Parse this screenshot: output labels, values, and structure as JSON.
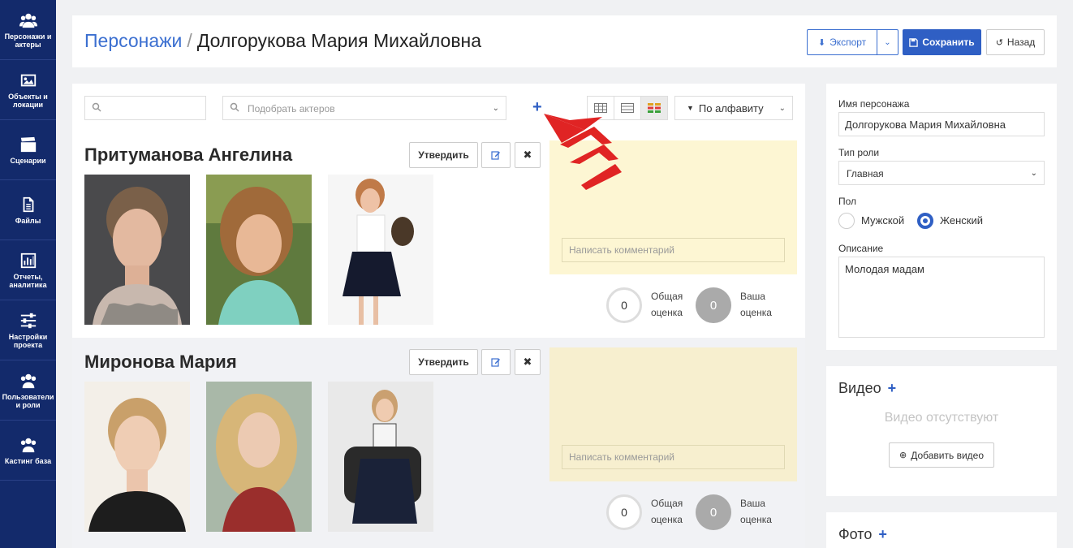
{
  "sidebar": {
    "items": [
      {
        "label": "Персонажи и актеры",
        "icon": "users-icon"
      },
      {
        "label": "Объекты и локации",
        "icon": "image-icon"
      },
      {
        "label": "Сценарии",
        "icon": "clapperboard-icon"
      },
      {
        "label": "Файлы",
        "icon": "file-icon"
      },
      {
        "label": "Отчеты, аналитика",
        "icon": "chart-icon"
      },
      {
        "label": "Настройки проекта",
        "icon": "sliders-icon"
      },
      {
        "label": "Пользователи и роли",
        "icon": "users-icon"
      },
      {
        "label": "Кастинг база",
        "icon": "users-icon"
      }
    ]
  },
  "header": {
    "breadcrumb": "Персонажи",
    "separator": "/",
    "title": "Долгорукова Мария Михайловна",
    "export_label": "Экспорт",
    "save_label": "Сохранить",
    "back_label": "Назад"
  },
  "toolbar": {
    "search_placeholder": "",
    "actor_pick_placeholder": "Подобрать актеров",
    "add_symbol": "+",
    "sort_label": "По алфавиту"
  },
  "actors": [
    {
      "name": "Притуманова Ангелина",
      "approve_label": "Утвердить",
      "comment_placeholder": "Написать комментарий",
      "total_score": "0",
      "total_label": "Общая оценка",
      "my_score": "0",
      "my_label": "Ваша оценка"
    },
    {
      "name": "Миронова Мария",
      "approve_label": "Утвердить",
      "comment_placeholder": "Написать комментарий",
      "total_score": "0",
      "total_label": "Общая оценка",
      "my_score": "0",
      "my_label": "Ваша оценка"
    }
  ],
  "character": {
    "name_label": "Имя персонажа",
    "name_value": "Долгорукова Мария Михайловна",
    "role_label": "Тип роли",
    "role_value": "Главная",
    "gender_label": "Пол",
    "gender_male": "Мужской",
    "gender_female": "Женский",
    "gender_selected": "Женский",
    "desc_label": "Описание",
    "desc_value": "Молодая мадам"
  },
  "video": {
    "title": "Видео",
    "empty": "Видео отсутствуют",
    "add_label": "Добавить видео"
  },
  "photo": {
    "title": "Фото"
  },
  "colors": {
    "sidebar": "#132a6b",
    "accent": "#2f5fc4",
    "note": "#fdf6d3",
    "arrow": "#e02424"
  }
}
